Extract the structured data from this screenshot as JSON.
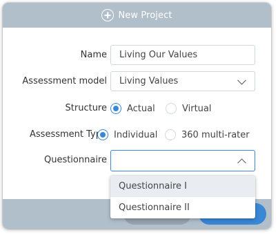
{
  "dialog": {
    "title": "New Project"
  },
  "form": {
    "name": {
      "label": "Name",
      "value": "Living Our Values"
    },
    "assessment_model": {
      "label": "Assessment model",
      "value": "Living Values"
    },
    "structure": {
      "label": "Structure",
      "options": [
        {
          "label": "Actual",
          "checked": true
        },
        {
          "label": "Virtual",
          "checked": false
        }
      ]
    },
    "assessment_type": {
      "label": "Assessment Type",
      "options": [
        {
          "label": "Individual",
          "checked": true
        },
        {
          "label": "360 multi-rater",
          "checked": false
        }
      ]
    },
    "questionnaire": {
      "label": "Questionnaire",
      "value": "",
      "open": true,
      "options": [
        "Questionnaire I",
        "Questionnaire II"
      ]
    }
  },
  "colors": {
    "header": "#b1bfcb",
    "accent": "#3a87d6",
    "cancel_button": "#97a3ae"
  },
  "icons": [
    "plus-circle-icon",
    "chevron-down-icon",
    "chevron-up-icon"
  ]
}
